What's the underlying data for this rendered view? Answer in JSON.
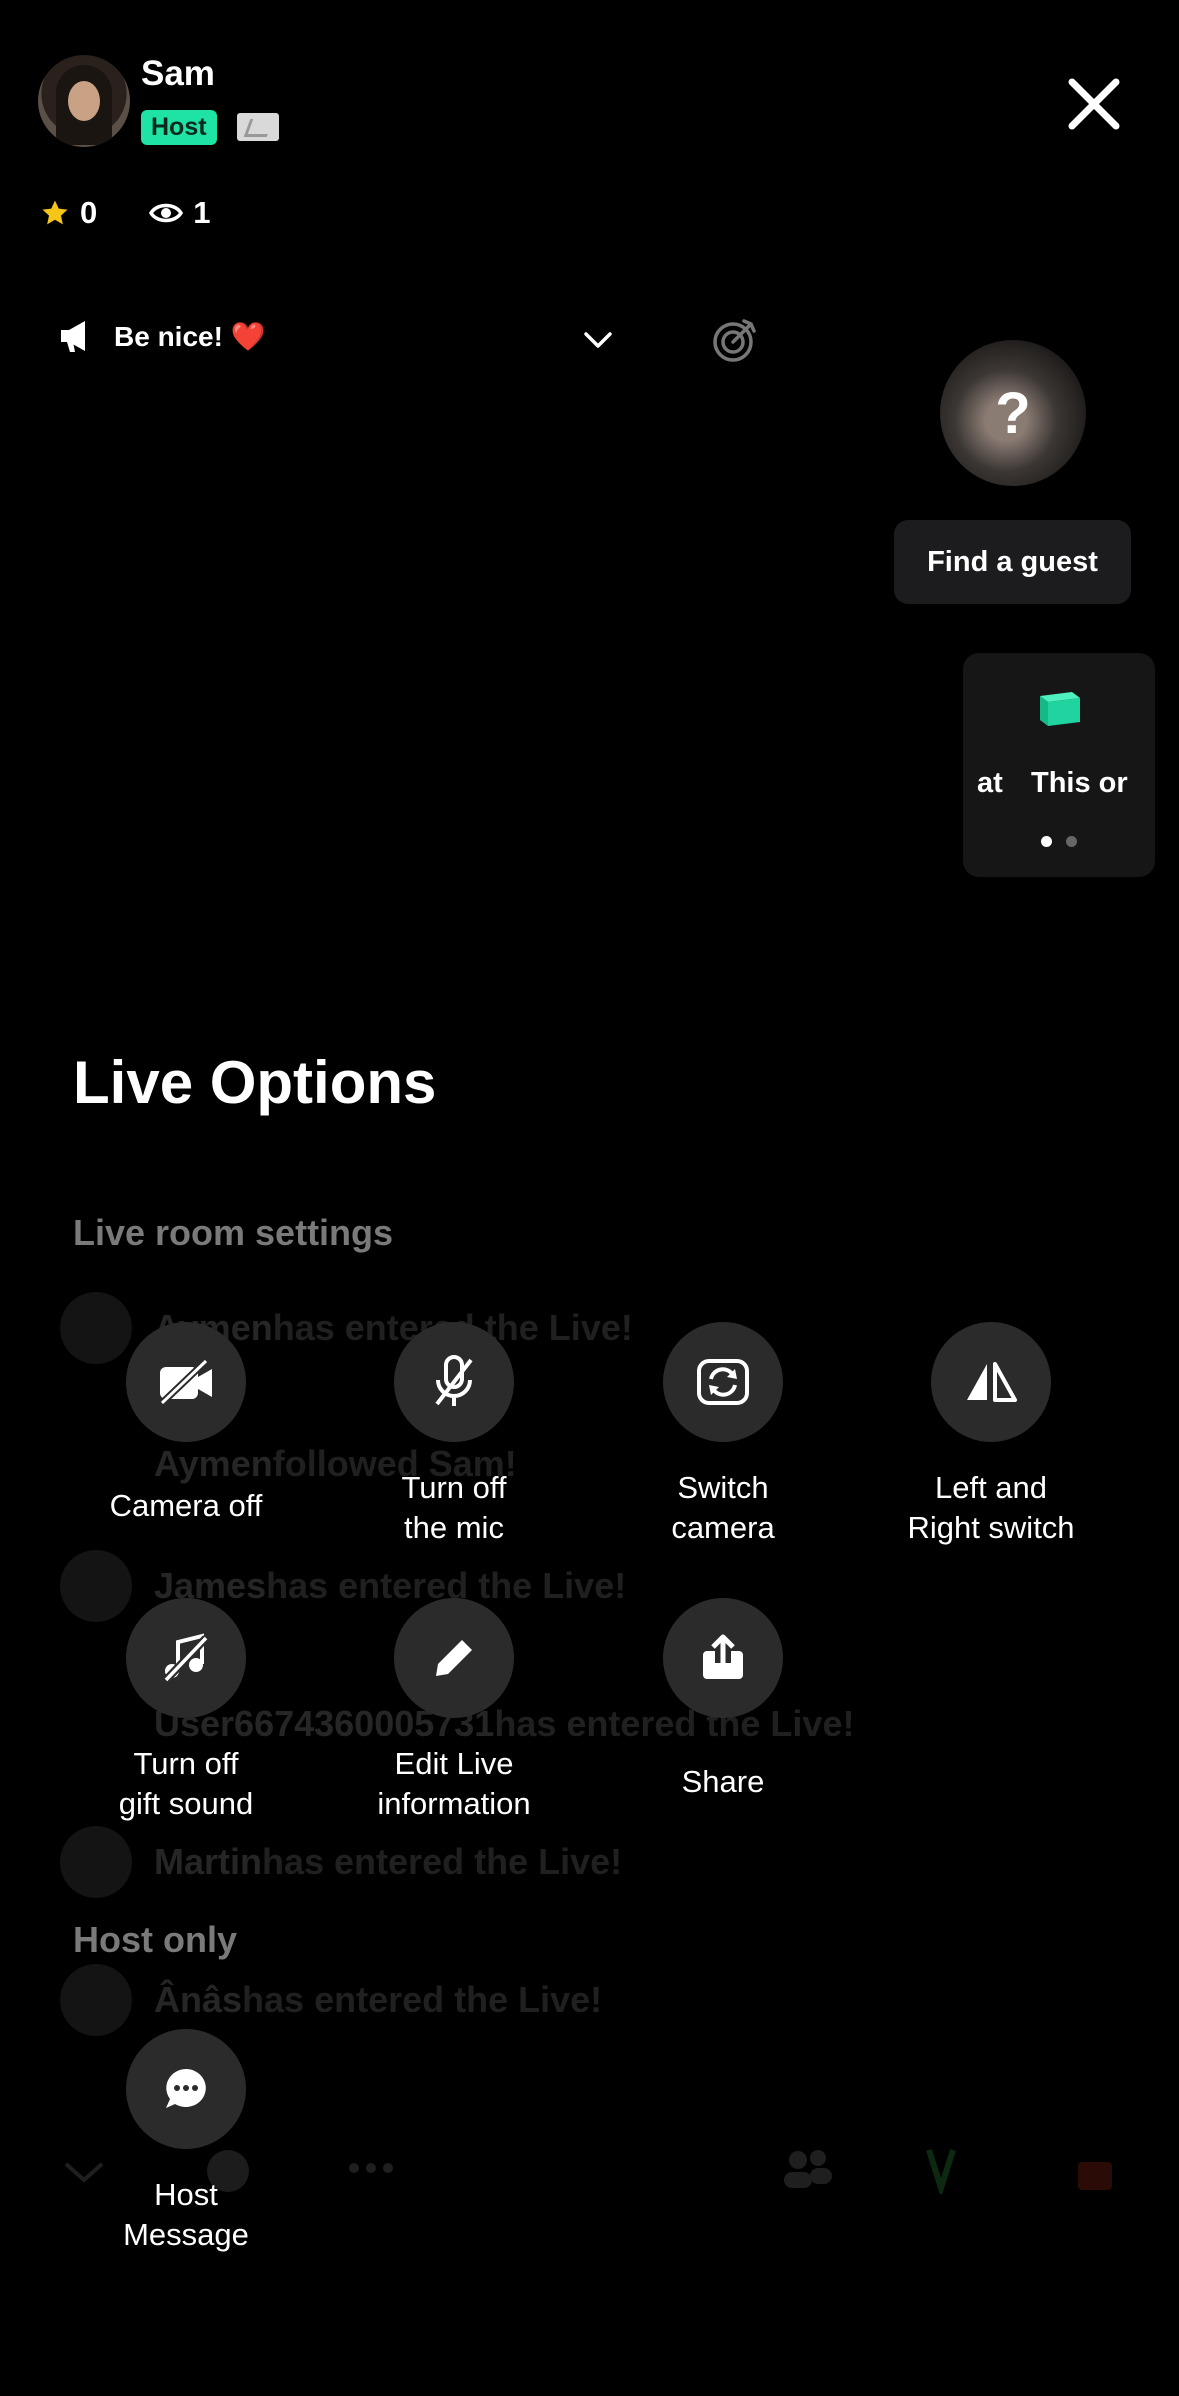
{
  "host": {
    "name": "Sam",
    "badge": "Host"
  },
  "stats": {
    "stars": "0",
    "viewers": "1"
  },
  "announcement": {
    "text": "Be nice! ❤️"
  },
  "guest": {
    "placeholder": "?",
    "find_label": "Find a guest"
  },
  "game_card": {
    "left_text": "at",
    "right_text": "This or"
  },
  "chat": {
    "lines": [
      {
        "name": "Aymen",
        "message": " has entered the Live!"
      },
      {
        "name": "Aymen",
        "message": " followed Sam!"
      },
      {
        "name": "James",
        "message": " has entered the Live!"
      },
      {
        "name": "User6674360005731",
        "message": " has entered the Live!"
      },
      {
        "name": "Martin",
        "message": " has entered the Live!"
      },
      {
        "name": "Ânâs",
        "message": " has entered the Live!"
      }
    ]
  },
  "sheet": {
    "title": "Live Options",
    "section_settings": "Live room settings",
    "section_host": "Host only",
    "options": {
      "camera_off": "Camera off",
      "mic_off": "Turn off\nthe mic",
      "switch_camera": "Switch\ncamera",
      "lr_switch": "Left and\nRight switch",
      "gift_sound": "Turn off\ngift sound",
      "edit_info": "Edit Live\ninformation",
      "share": "Share",
      "host_message": "Host\nMessage"
    }
  },
  "colors": {
    "accent_green": "#1ee3a5",
    "circle_bg": "#2b2b2b",
    "section_gray": "#7a7a7a",
    "star_yellow": "#f5c518"
  }
}
